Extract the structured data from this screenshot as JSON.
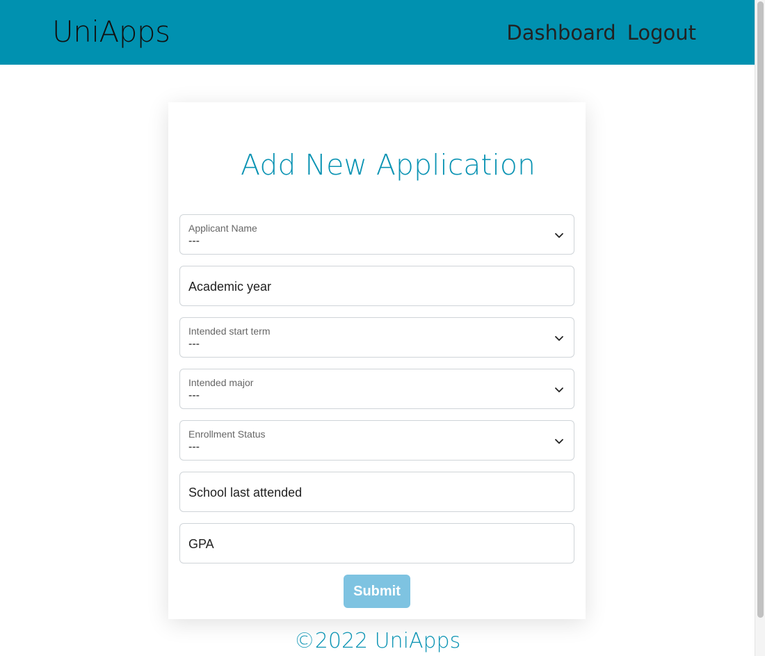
{
  "header": {
    "brand": "UniApps",
    "nav": [
      {
        "label": "Dashboard"
      },
      {
        "label": "Logout"
      }
    ]
  },
  "form": {
    "title": "Add New Application",
    "fields": [
      {
        "label": "Applicant Name",
        "value": "---",
        "type": "select"
      },
      {
        "placeholder": "Academic year",
        "type": "input"
      },
      {
        "label": "Intended start term",
        "value": "---",
        "type": "select"
      },
      {
        "label": "Intended major",
        "value": "---",
        "type": "select"
      },
      {
        "label": "Enrollment Status",
        "value": "---",
        "type": "select"
      },
      {
        "placeholder": "School last attended",
        "type": "input"
      },
      {
        "placeholder": "GPA",
        "type": "input"
      }
    ],
    "submit_label": "Submit"
  },
  "footer": {
    "text": "©2022 UniApps"
  },
  "colors": {
    "navbar": "#0091b0",
    "accent": "#0a93b3",
    "submit_disabled": "#7ec3e1"
  },
  "icons": {
    "select_arrow": "chevron-down-icon"
  }
}
